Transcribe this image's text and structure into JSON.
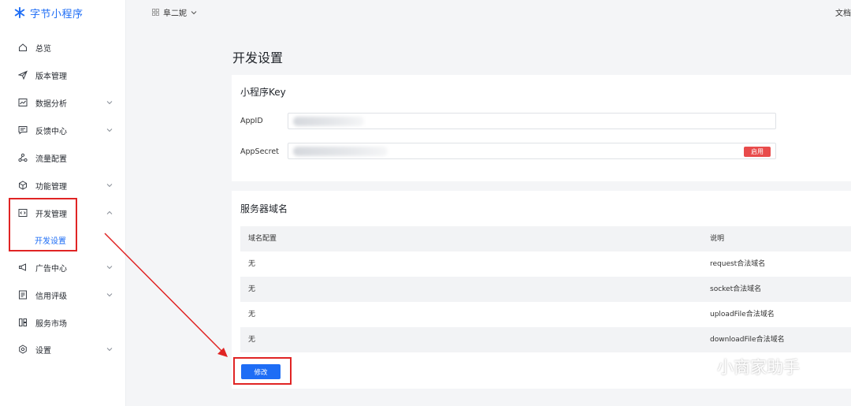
{
  "brand": {
    "name": "字节小程序",
    "color": "#1e6df5"
  },
  "topbar": {
    "app_name": "阜二妮",
    "doc_link": "文档"
  },
  "sidebar": {
    "items": [
      {
        "label": "总览",
        "icon": "home-icon",
        "expandable": false
      },
      {
        "label": "版本管理",
        "icon": "send-icon",
        "expandable": false
      },
      {
        "label": "数据分析",
        "icon": "chart-icon",
        "expandable": true
      },
      {
        "label": "反馈中心",
        "icon": "message-icon",
        "expandable": true
      },
      {
        "label": "流量配置",
        "icon": "share-icon",
        "expandable": false
      },
      {
        "label": "功能管理",
        "icon": "cube-icon",
        "expandable": true
      },
      {
        "label": "开发管理",
        "icon": "code-icon",
        "expandable": true,
        "expanded": true
      },
      {
        "label": "广告中心",
        "icon": "megaphone-icon",
        "expandable": true
      },
      {
        "label": "信用评级",
        "icon": "document-icon",
        "expandable": true
      },
      {
        "label": "服务市场",
        "icon": "layout-icon",
        "expandable": false
      },
      {
        "label": "设置",
        "icon": "gear-icon",
        "expandable": true
      }
    ],
    "sub_item": {
      "label": "开发设置",
      "active": true
    }
  },
  "main": {
    "page_title": "开发设置",
    "key_card": {
      "title": "小程序Key",
      "appid_label": "AppID",
      "appsecret_label": "AppSecret",
      "enable_button": "启用"
    },
    "domain_card": {
      "title": "服务器域名",
      "columns": [
        "域名配置",
        "说明"
      ],
      "rows": [
        [
          "无",
          "request合法域名"
        ],
        [
          "无",
          "socket合法域名"
        ],
        [
          "无",
          "uploadFile合法域名"
        ],
        [
          "无",
          "downloadFile合法域名"
        ]
      ],
      "modify_button": "修改"
    }
  },
  "annotation_color": "#e02424",
  "watermark": "小商家助手"
}
